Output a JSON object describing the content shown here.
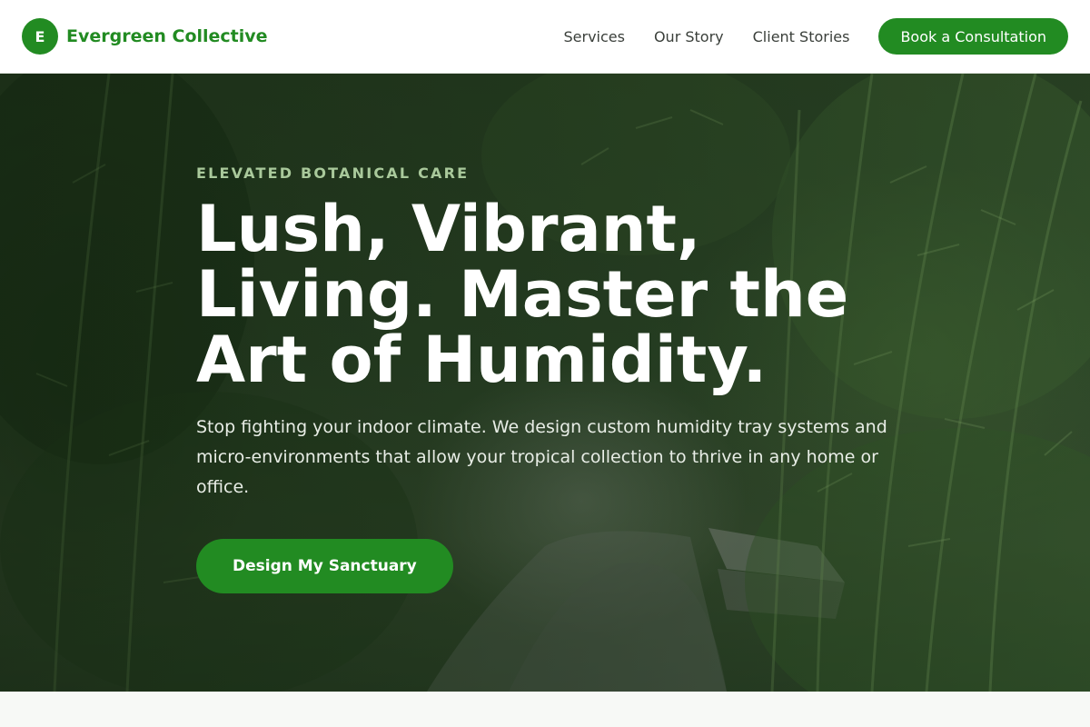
{
  "brand": {
    "mark_letter": "E",
    "name": "Evergreen Collective"
  },
  "nav": {
    "links": [
      "Services",
      "Our Story",
      "Client Stories"
    ],
    "cta_label": "Book a Consultation"
  },
  "hero": {
    "eyebrow": "ELEVATED BOTANICAL CARE",
    "headline": "Lush, Vibrant, Living. Master the Art of Humidity.",
    "subtext": "Stop fighting your indoor climate. We design custom humidity tray systems and micro-environments that allow your tropical collection to thrive in any home or office.",
    "cta_label": "Design My Sanctuary"
  },
  "colors": {
    "brand_green": "#228b22",
    "eyebrow_green": "#a9c99b",
    "hero_text": "#ffffff"
  }
}
